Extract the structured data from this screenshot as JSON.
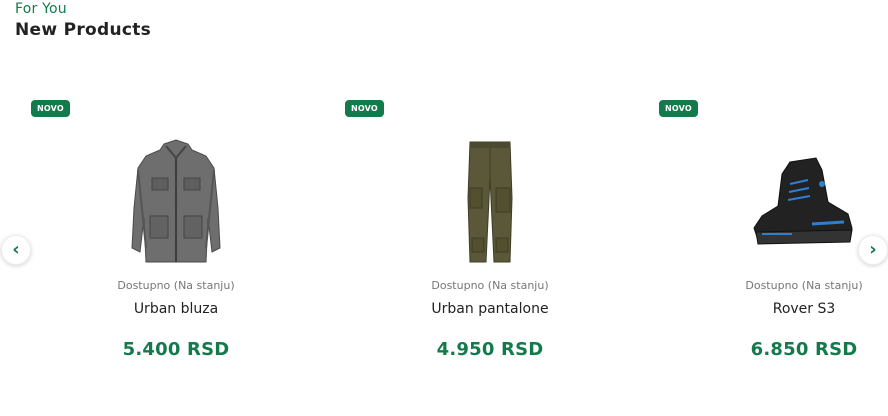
{
  "section": {
    "eyebrow": "For You",
    "title": "New Products"
  },
  "nav": {
    "prev_icon": "chevron-left-icon",
    "prev_glyph": "‹",
    "next_icon": "chevron-right-icon",
    "next_glyph": "›"
  },
  "accent_color": "#137a4c",
  "products": [
    {
      "badge": "NOVO",
      "availability": "Dostupno (Na stanju)",
      "name": "Urban bluza",
      "price": "5.400 RSD",
      "image": "grey-work-jacket"
    },
    {
      "badge": "NOVO",
      "availability": "Dostupno (Na stanju)",
      "name": "Urban pantalone",
      "price": "4.950 RSD",
      "image": "olive-work-trousers"
    },
    {
      "badge": "NOVO",
      "availability": "Dostupno (Na stanju)",
      "name": "Rover S3",
      "price": "6.850 RSD",
      "image": "black-safety-boot"
    }
  ]
}
